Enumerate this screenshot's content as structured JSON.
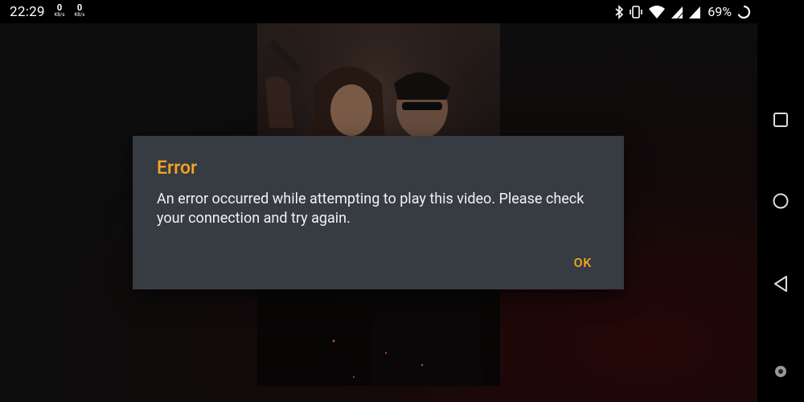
{
  "status_bar": {
    "time": "22:29",
    "net_up": {
      "value": "0",
      "unit": "KB/s"
    },
    "net_down": {
      "value": "0",
      "unit": "KB/s"
    },
    "battery_percent": "69%",
    "icons": [
      "bluetooth-icon",
      "vibrate-icon",
      "wifi-icon",
      "signal-icon",
      "signal-roaming-icon",
      "battery-icon"
    ]
  },
  "dialog": {
    "title": "Error",
    "message": "An error occurred while attempting to play this video. Please check your connection and try again.",
    "ok_label": "OK"
  },
  "colors": {
    "accent": "#f5a623",
    "dialog_bg": "#373b42"
  },
  "nav_bar": {
    "buttons": [
      "recent-apps-icon",
      "home-icon",
      "back-icon",
      "accessibility-dot-icon"
    ]
  }
}
